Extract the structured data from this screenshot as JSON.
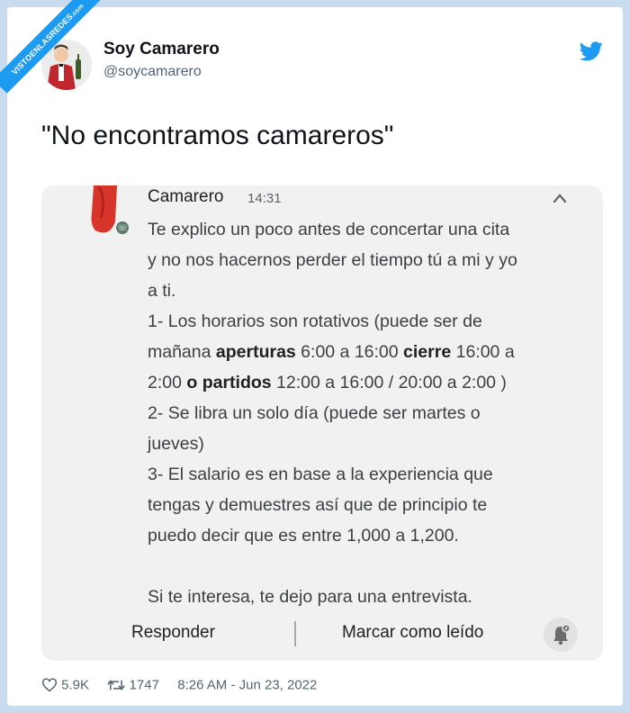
{
  "watermark": {
    "text": "VISTOENLASREDES",
    "sub": ".com"
  },
  "author": {
    "name": "Soy Camarero",
    "handle": "@soycamarero",
    "avatar_icon": "waiter-avatar-icon"
  },
  "brand": {
    "icon": "twitter-bird-icon",
    "color": "#1d9bf0"
  },
  "tweet": {
    "text": "\"No encontramos camareros\""
  },
  "message": {
    "sender": "Camarero",
    "time": "14:31",
    "lines": [
      {
        "parts": [
          {
            "t": "Te explico un poco antes de concertar una cita"
          }
        ]
      },
      {
        "parts": [
          {
            "t": "y no nos hacernos perder el tiempo tú a mi y yo"
          }
        ]
      },
      {
        "parts": [
          {
            "t": "a ti."
          }
        ]
      },
      {
        "parts": [
          {
            "t": "1- Los horarios son rotativos (puede ser de"
          }
        ]
      },
      {
        "parts": [
          {
            "t": "mañana "
          },
          {
            "t": "aperturas",
            "b": true
          },
          {
            "t": " 6:00 a 16:00 "
          },
          {
            "t": "cierre",
            "b": true
          },
          {
            "t": " 16:00 a"
          }
        ]
      },
      {
        "parts": [
          {
            "t": "2:00 "
          },
          {
            "t": "o partidos",
            "b": true
          },
          {
            "t": " 12:00 a 16:00 / 20:00 a 2:00 )"
          }
        ]
      },
      {
        "parts": [
          {
            "t": "2- Se libra un solo día (puede ser martes o"
          }
        ]
      },
      {
        "parts": [
          {
            "t": "jueves)"
          }
        ]
      },
      {
        "parts": [
          {
            "t": "3- El salario es en base a la experiencia que"
          }
        ]
      },
      {
        "parts": [
          {
            "t": "tengas y demuestres así que de principio te"
          }
        ]
      },
      {
        "parts": [
          {
            "t": "puedo decir que es entre 1,000 a 1,200."
          }
        ]
      },
      {
        "parts": [
          {
            "t": ""
          }
        ]
      },
      {
        "parts": [
          {
            "t": "Si te interesa, te dejo para una entrevista."
          }
        ]
      }
    ],
    "actions": {
      "reply": "Responder",
      "mark_read": "Marcar como leído"
    }
  },
  "stats": {
    "likes": "5.9K",
    "retweets": "1747",
    "timestamp": "8:26 AM - Jun 23, 2022"
  }
}
